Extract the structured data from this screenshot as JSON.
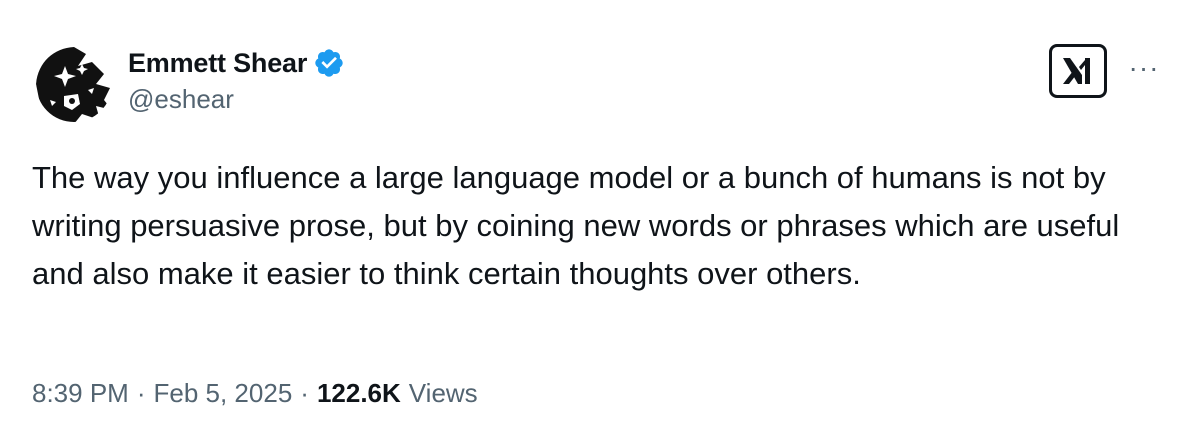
{
  "author": {
    "display_name": "Emmett Shear",
    "handle": "@eshear",
    "verified": true,
    "verified_color": "#1d9bf0"
  },
  "header": {
    "brand_icon": "x-logo-icon",
    "more_label": "···"
  },
  "tweet": {
    "text": "The way you influence a large language model or a bunch of humans is not by writing persuasive prose, but by coining new words or phrases which are useful and also make it easier to think certain thoughts over others."
  },
  "meta": {
    "time": "8:39 PM",
    "separator": "·",
    "date": "Feb 5, 2025",
    "views_count": "122.6K",
    "views_label": "Views"
  }
}
